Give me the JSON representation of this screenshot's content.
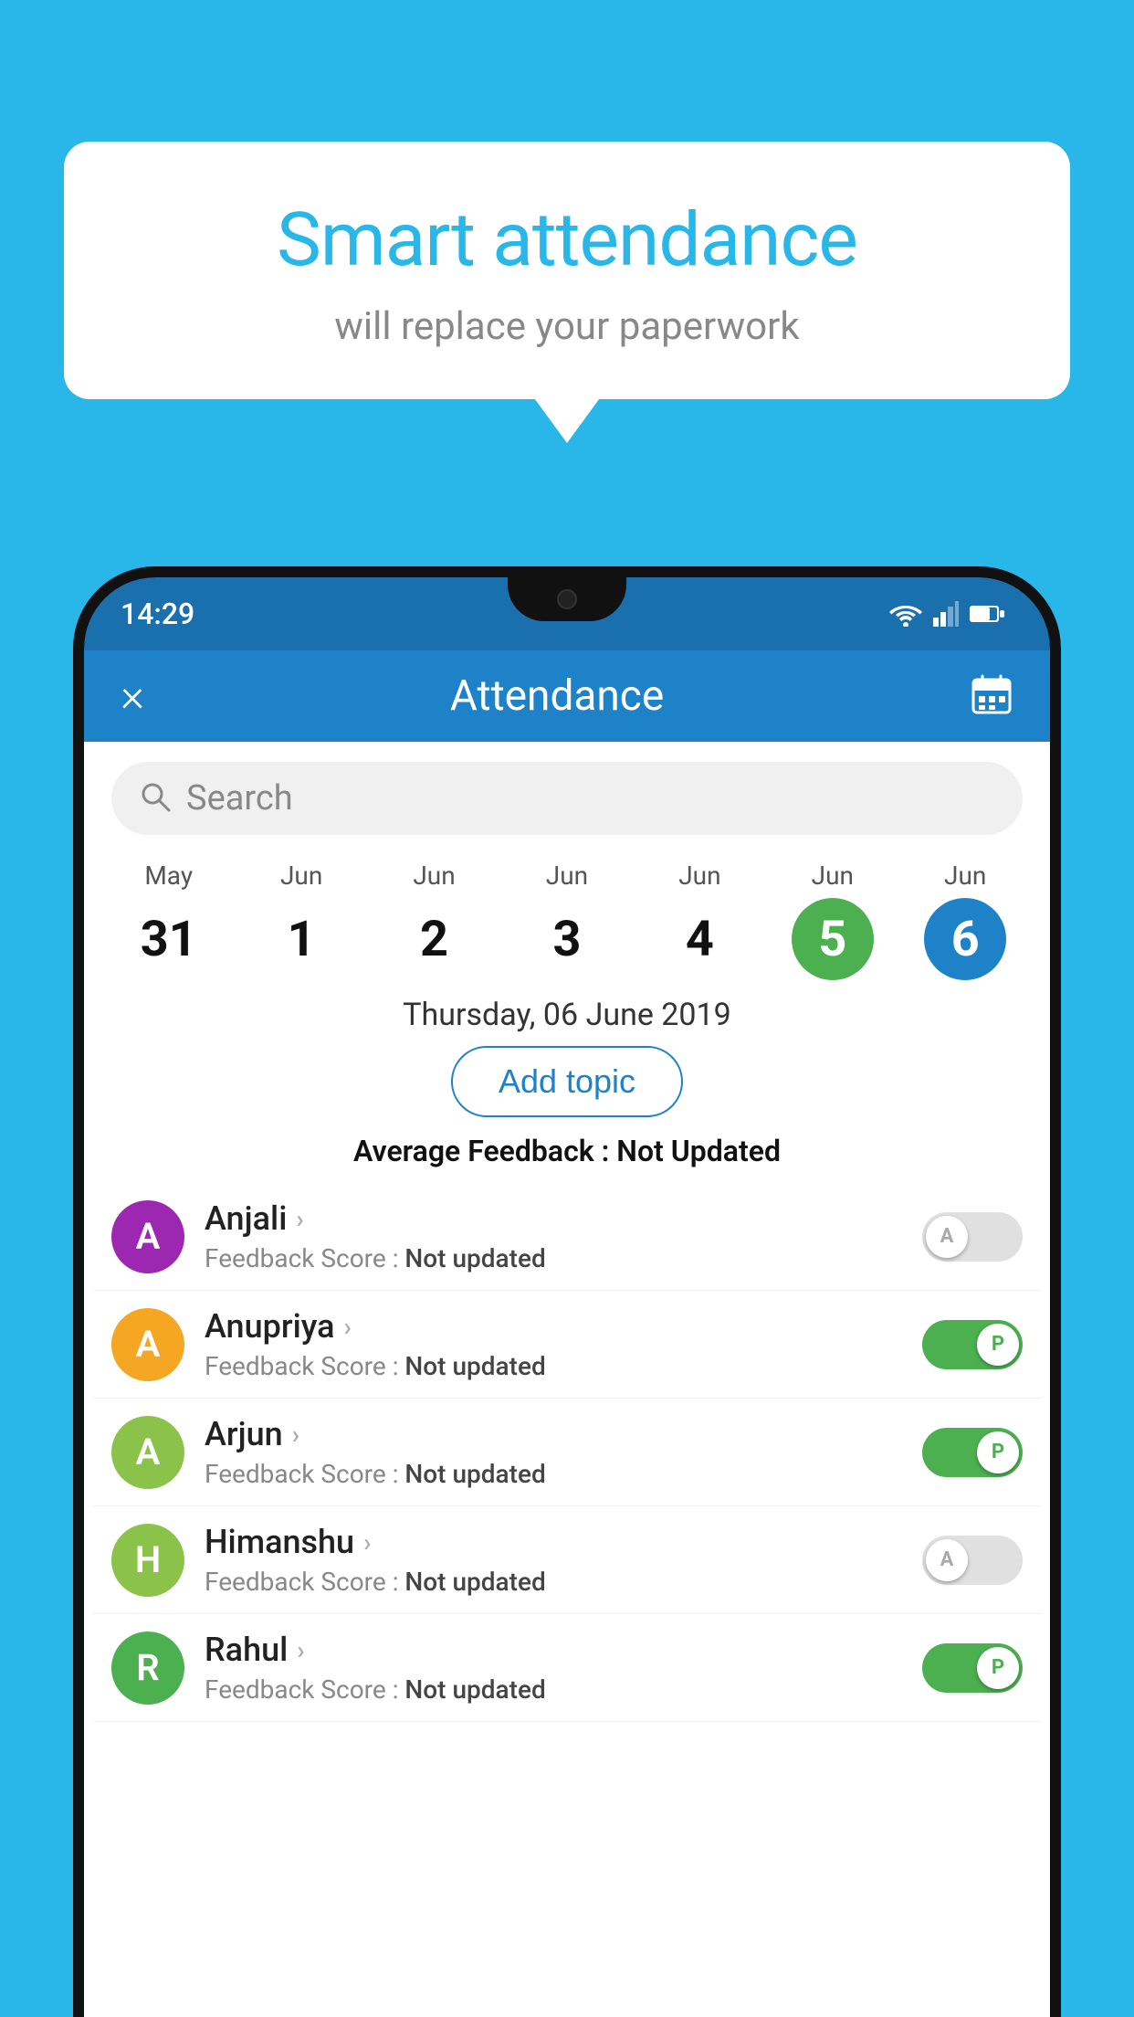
{
  "background_color": "#29b6e8",
  "speech_bubble": {
    "title": "Smart attendance",
    "subtitle": "will replace your paperwork"
  },
  "status_bar": {
    "time": "14:29"
  },
  "app_header": {
    "title": "Attendance",
    "close_label": "×",
    "calendar_icon": "calendar-icon"
  },
  "search": {
    "placeholder": "Search"
  },
  "calendar": {
    "days": [
      {
        "month": "May",
        "day": "31",
        "state": "normal"
      },
      {
        "month": "Jun",
        "day": "1",
        "state": "normal"
      },
      {
        "month": "Jun",
        "day": "2",
        "state": "normal"
      },
      {
        "month": "Jun",
        "day": "3",
        "state": "normal"
      },
      {
        "month": "Jun",
        "day": "4",
        "state": "normal"
      },
      {
        "month": "Jun",
        "day": "5",
        "state": "today"
      },
      {
        "month": "Jun",
        "day": "6",
        "state": "selected"
      }
    ],
    "selected_date_label": "Thursday, 06 June 2019"
  },
  "add_topic": {
    "label": "Add topic"
  },
  "avg_feedback": {
    "label": "Average Feedback :",
    "value": "Not Updated"
  },
  "students": [
    {
      "name": "Anjali",
      "initials": "A",
      "avatar_color": "#9c27b0",
      "feedback_label": "Feedback Score :",
      "feedback_value": "Not updated",
      "attendance": "absent",
      "toggle_label": "A"
    },
    {
      "name": "Anupriya",
      "initials": "A",
      "avatar_color": "#f5a623",
      "feedback_label": "Feedback Score :",
      "feedback_value": "Not updated",
      "attendance": "present",
      "toggle_label": "P"
    },
    {
      "name": "Arjun",
      "initials": "A",
      "avatar_color": "#8bc34a",
      "feedback_label": "Feedback Score :",
      "feedback_value": "Not updated",
      "attendance": "present",
      "toggle_label": "P"
    },
    {
      "name": "Himanshu",
      "initials": "H",
      "avatar_color": "#8bc34a",
      "feedback_label": "Feedback Score :",
      "feedback_value": "Not updated",
      "attendance": "absent",
      "toggle_label": "A"
    },
    {
      "name": "Rahul",
      "initials": "R",
      "avatar_color": "#4CAF50",
      "feedback_label": "Feedback Score :",
      "feedback_value": "Not updated",
      "attendance": "present",
      "toggle_label": "P"
    }
  ]
}
